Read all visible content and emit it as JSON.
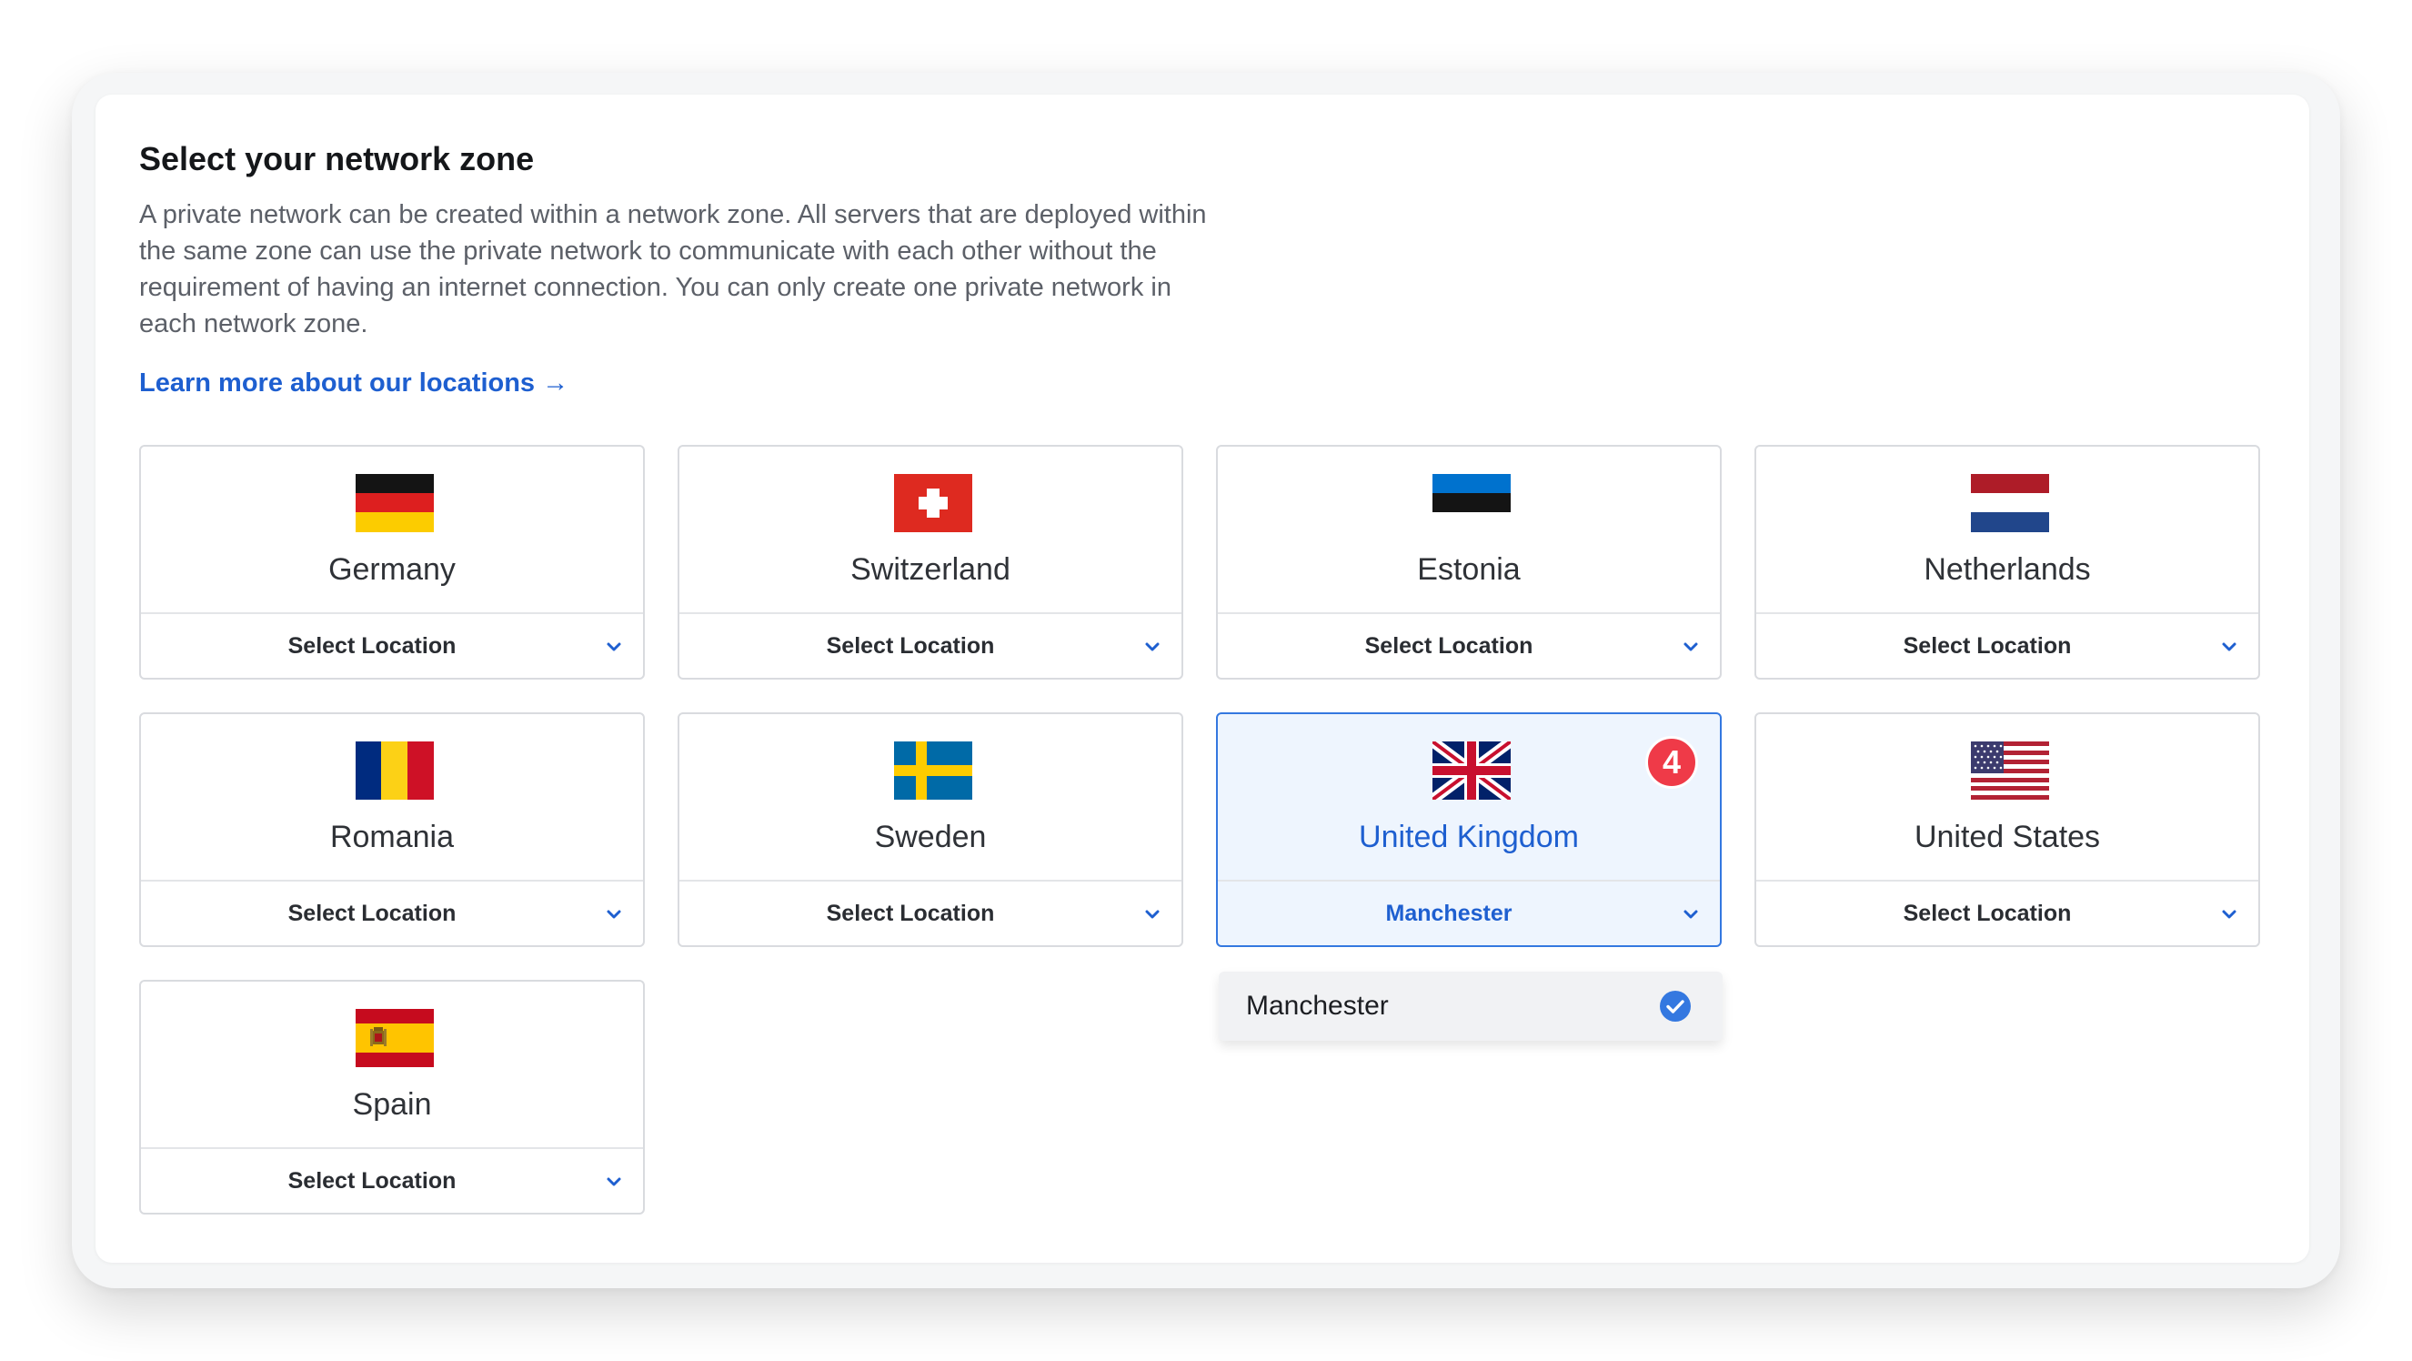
{
  "title": "Select your network zone",
  "description": "A private network can be created within a network zone. All servers that are deployed within the same zone can use the private network to communicate with each other without the requirement of having an internet connection. You can only create one private network in each network zone.",
  "learn_more": "Learn more about our locations →",
  "zones": [
    {
      "name": "Germany",
      "select": "Select Location",
      "flag": "germany-flag"
    },
    {
      "name": "Switzerland",
      "select": "Select Location",
      "flag": "switzerland-flag"
    },
    {
      "name": "Estonia",
      "select": "Select Location",
      "flag": "estonia-flag"
    },
    {
      "name": "Netherlands",
      "select": "Select Location",
      "flag": "netherlands-flag"
    },
    {
      "name": "Romania",
      "select": "Select Location",
      "flag": "romania-flag"
    },
    {
      "name": "Sweden",
      "select": "Select Location",
      "flag": "sweden-flag"
    },
    {
      "name": "United Kingdom",
      "select": "Manchester",
      "flag": "united-kingdom-flag",
      "selected": true,
      "badge": "4"
    },
    {
      "name": "United States",
      "select": "Select Location",
      "flag": "united-states-flag"
    },
    {
      "name": "Spain",
      "select": "Select Location",
      "flag": "spain-flag"
    }
  ],
  "dropdown": {
    "option": "Manchester",
    "icon": "check-circle-icon"
  },
  "colors": {
    "accent": "#1e5fd0",
    "selected_bg": "#eef5fe",
    "badge": "#ef3a48"
  }
}
